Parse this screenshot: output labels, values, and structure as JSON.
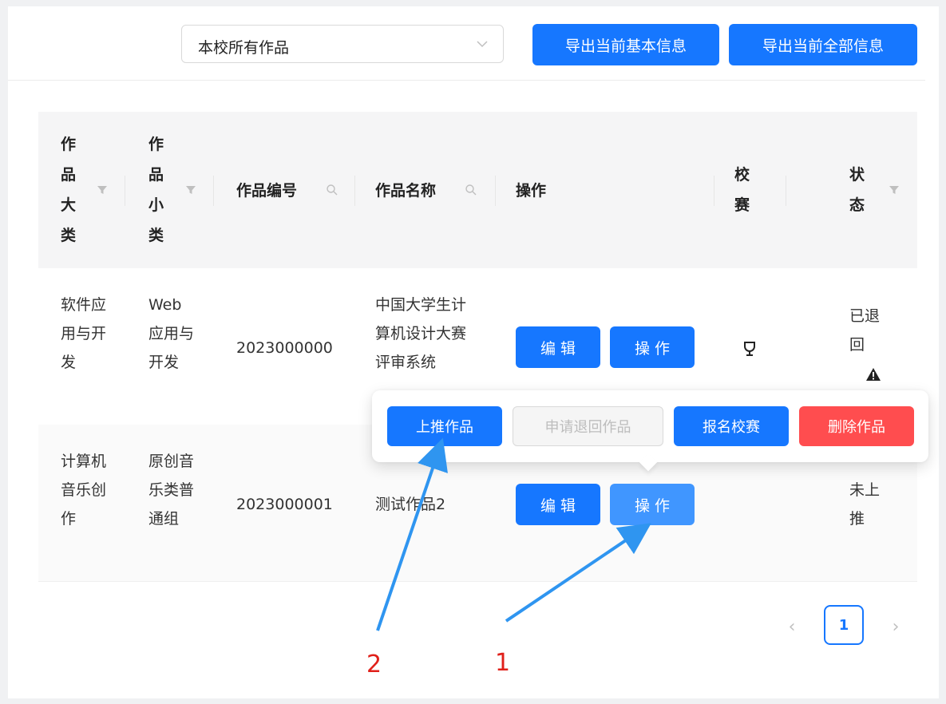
{
  "toolbar": {
    "select_value": "本校所有作品",
    "export_basic_label": "导出当前基本信息",
    "export_all_label": "导出当前全部信息"
  },
  "table": {
    "columns": [
      "作品大类",
      "作品小类",
      "作品编号",
      "作品名称",
      "操作",
      "校赛",
      "状态"
    ],
    "rows": [
      {
        "category": "软件应用与开发",
        "subcategory": "Web应用与开发",
        "id": "2023000000",
        "name": "中国大学生计算机设计大赛评审系统",
        "edit_label": "编辑",
        "op_label": "操作",
        "contest_icon": "trophy-icon",
        "status": "已退回",
        "status_icon": "warning-icon"
      },
      {
        "category": "计算机音乐创作",
        "subcategory": "原创音乐类普通组",
        "id": "2023000001",
        "name": "测试作品2",
        "edit_label": "编辑",
        "op_label": "操作",
        "status": "未上推"
      }
    ]
  },
  "popover": {
    "push_label": "上推作品",
    "request_return_label": "申请退回作品",
    "register_label": "报名校赛",
    "delete_label": "删除作品"
  },
  "pagination": {
    "current_page": "1"
  },
  "annotations": {
    "label_1": "1",
    "label_2": "2"
  },
  "colors": {
    "primary": "#1677ff",
    "danger": "#ff4d4f",
    "annotation_arrow": "#2f95f0",
    "annotation_text": "#e0201a"
  }
}
